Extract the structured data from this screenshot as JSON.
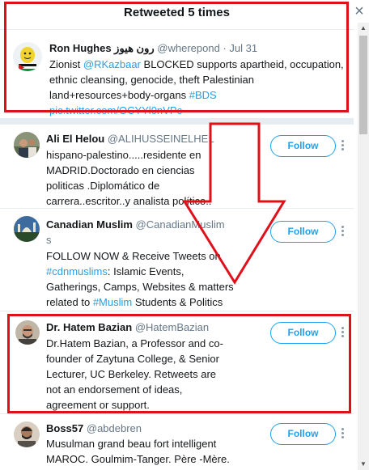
{
  "modal": {
    "title": "Retweeted 5 times",
    "close_icon": "×"
  },
  "original_tweet": {
    "name": "Ron Hughes رون هيوز",
    "handle": "@wherepond",
    "date": "· Jul 31",
    "text_1": "Zionist ",
    "mention": "@RKazbaar",
    "text_2": " BLOCKED supports apartheid, occupation, ethnic cleansing, genocide, theft Palestinian land+resources+body-organs ",
    "hashtag": "#BDS",
    "link": "pic.twitter.com/OCYYl0nVPc"
  },
  "retweeters": [
    {
      "name": "Ali El Helou",
      "handle": "@ALIHUSSEINELHEL",
      "bio": "hispano-palestino.....residente en MADRID.Doctorado en ciencias politicas .Diplomático de carrera..escritor..y analista político..",
      "follow_label": "Follow"
    },
    {
      "name": "Canadian Muslim",
      "handle": "@CanadianMuslim",
      "handle_wrap": "s",
      "bio_1": "FOLLOW NOW & Receive Tweets on ",
      "bio_hashtag_1": "#cdnmuslims",
      "bio_2": ": Islamic Events, Gatherings, Camps, Websites & matters related to ",
      "bio_hashtag_2": "#Muslim",
      "bio_3": " Students & Politics",
      "follow_label": "Follow"
    },
    {
      "name": "Dr. Hatem Bazian",
      "handle": "@HatemBazian",
      "bio": "Dr.Hatem Bazian, a Professor and co-founder of Zaytuna College, & Senior Lecturer, UC Berkeley. Retweets are not an endorsement of ideas, agreement or support.",
      "follow_label": "Follow"
    },
    {
      "name": "Boss57",
      "handle": "@abdebren",
      "bio": "Musulman grand beau fort intelligent MAROC. Goulmim-Tanger. Père -Mère.",
      "follow_label": "Follow"
    }
  ],
  "scrollbar": {
    "up_icon": "▲",
    "down_icon": "▼"
  },
  "colors": {
    "accent": "#1da1f2",
    "annotation_red": "#e0101a",
    "separator": "#e6ecf0",
    "secondary_text": "#657786"
  }
}
